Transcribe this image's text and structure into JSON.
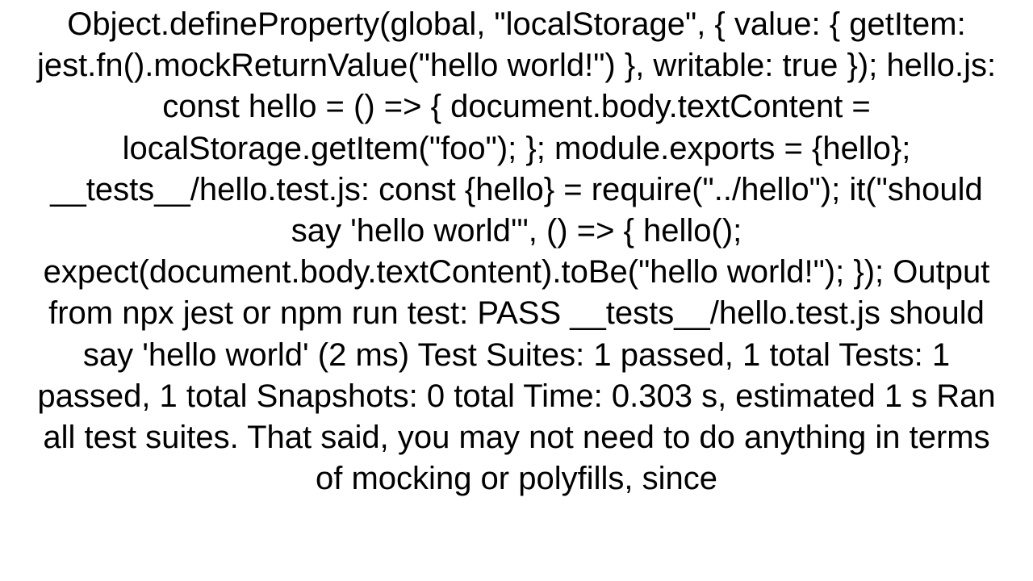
{
  "doc": {
    "text": "Object.defineProperty(global, \"localStorage\", {   value: {     getItem: jest.fn().mockReturnValue(\"hello world!\")   },   writable: true });  hello.js: const hello = () => {   document.body.textContent = localStorage.getItem(\"foo\"); };  module.exports = {hello};  __tests__/hello.test.js: const {hello} = require(\"../hello\");  it(\"should say 'hello world'\", () => {   hello();   expect(document.body.textContent).toBe(\"hello world!\"); });  Output from npx jest or npm run test:  PASS  __tests__/hello.test.js      should say 'hello world' (2 ms)  Test Suites: 1 passed, 1 total Tests:       1 passed, 1 total Snapshots:   0 total Time:        0.303 s, estimated 1 s Ran all test suites.  That said, you may not need to do anything in terms of mocking or polyfills, since"
  }
}
